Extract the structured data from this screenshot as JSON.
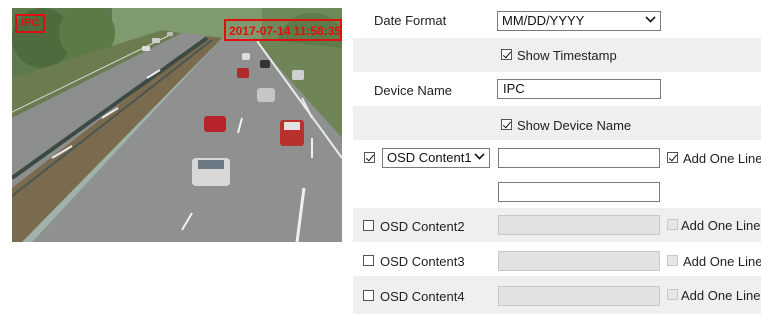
{
  "preview": {
    "osd_name_text": "IPC",
    "osd_time_text": "2017-07-14 11:58:35"
  },
  "settings": {
    "date_format": {
      "label": "Date Format",
      "value": "MM/DD/YYYY"
    },
    "show_timestamp": {
      "label": "Show Timestamp",
      "checked": true
    },
    "device_name": {
      "label": "Device Name",
      "value": "IPC"
    },
    "show_device_name": {
      "label": "Show Device Name",
      "checked": true
    },
    "osd_content1": {
      "select_value": "OSD Content1",
      "checked": true,
      "text_value": "",
      "text_value_2": "",
      "add_line_label": "Add One Line",
      "add_line_checked": true
    },
    "osd_content2": {
      "label": "OSD Content2",
      "checked": false,
      "add_line_label": "Add One Line"
    },
    "osd_content3": {
      "label": "OSD Content3",
      "checked": false,
      "add_line_label": "Add One Line"
    },
    "osd_content4": {
      "label": "OSD Content4",
      "checked": false,
      "add_line_label": "Add One Line"
    }
  },
  "colors": {
    "osd_red": "#e01010",
    "row_shade": "#efefef"
  }
}
